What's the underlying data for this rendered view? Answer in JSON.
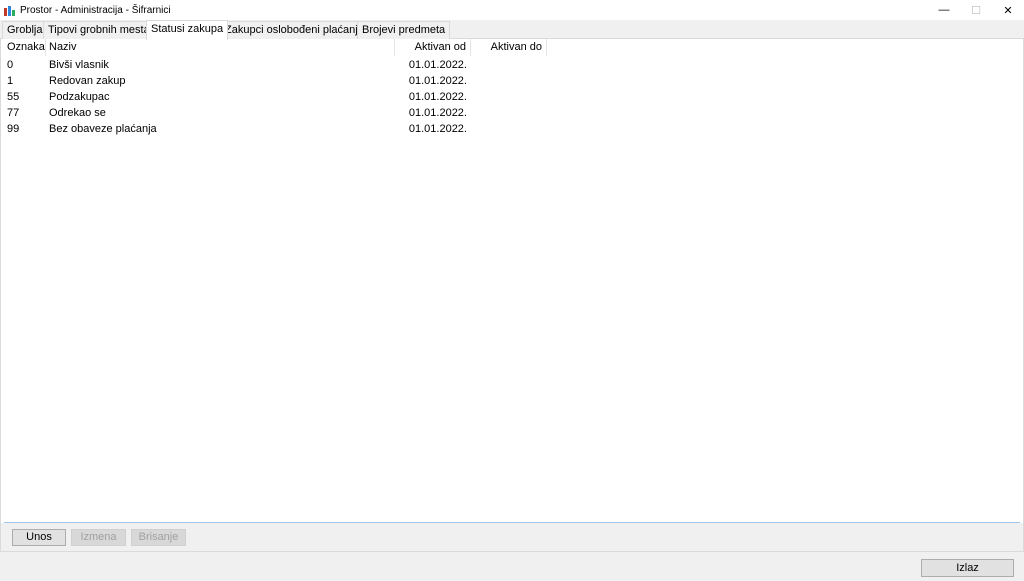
{
  "window": {
    "title": "Prostor - Administracija - Šifrarnici",
    "minimize": "—",
    "maximize": "☐",
    "close": "✕"
  },
  "tabs": [
    {
      "label": "Groblja"
    },
    {
      "label": "Tipovi grobnih mesta"
    },
    {
      "label": "Statusi zakupa",
      "active": true
    },
    {
      "label": "Zakupci oslobođeni plaćanja"
    },
    {
      "label": "Brojevi predmeta"
    }
  ],
  "table": {
    "columns": [
      "Oznaka",
      "Naziv",
      "Aktivan od",
      "Aktivan do"
    ],
    "rows": [
      {
        "oznaka": "0",
        "naziv": "Bivši vlasnik",
        "od": "01.01.2022.",
        "do": ""
      },
      {
        "oznaka": "1",
        "naziv": "Redovan zakup",
        "od": "01.01.2022.",
        "do": ""
      },
      {
        "oznaka": "55",
        "naziv": "Podzakupac",
        "od": "01.01.2022.",
        "do": ""
      },
      {
        "oznaka": "77",
        "naziv": "Odrekao se",
        "od": "01.01.2022.",
        "do": ""
      },
      {
        "oznaka": "99",
        "naziv": "Bez obaveze plaćanja",
        "od": "01.01.2022.",
        "do": ""
      }
    ]
  },
  "buttons": {
    "unos": "Unos",
    "izmena": "Izmena",
    "brisanje": "Brisanje",
    "izlaz": "Izlaz"
  },
  "icons": {
    "app": "bar-chart-icon"
  }
}
